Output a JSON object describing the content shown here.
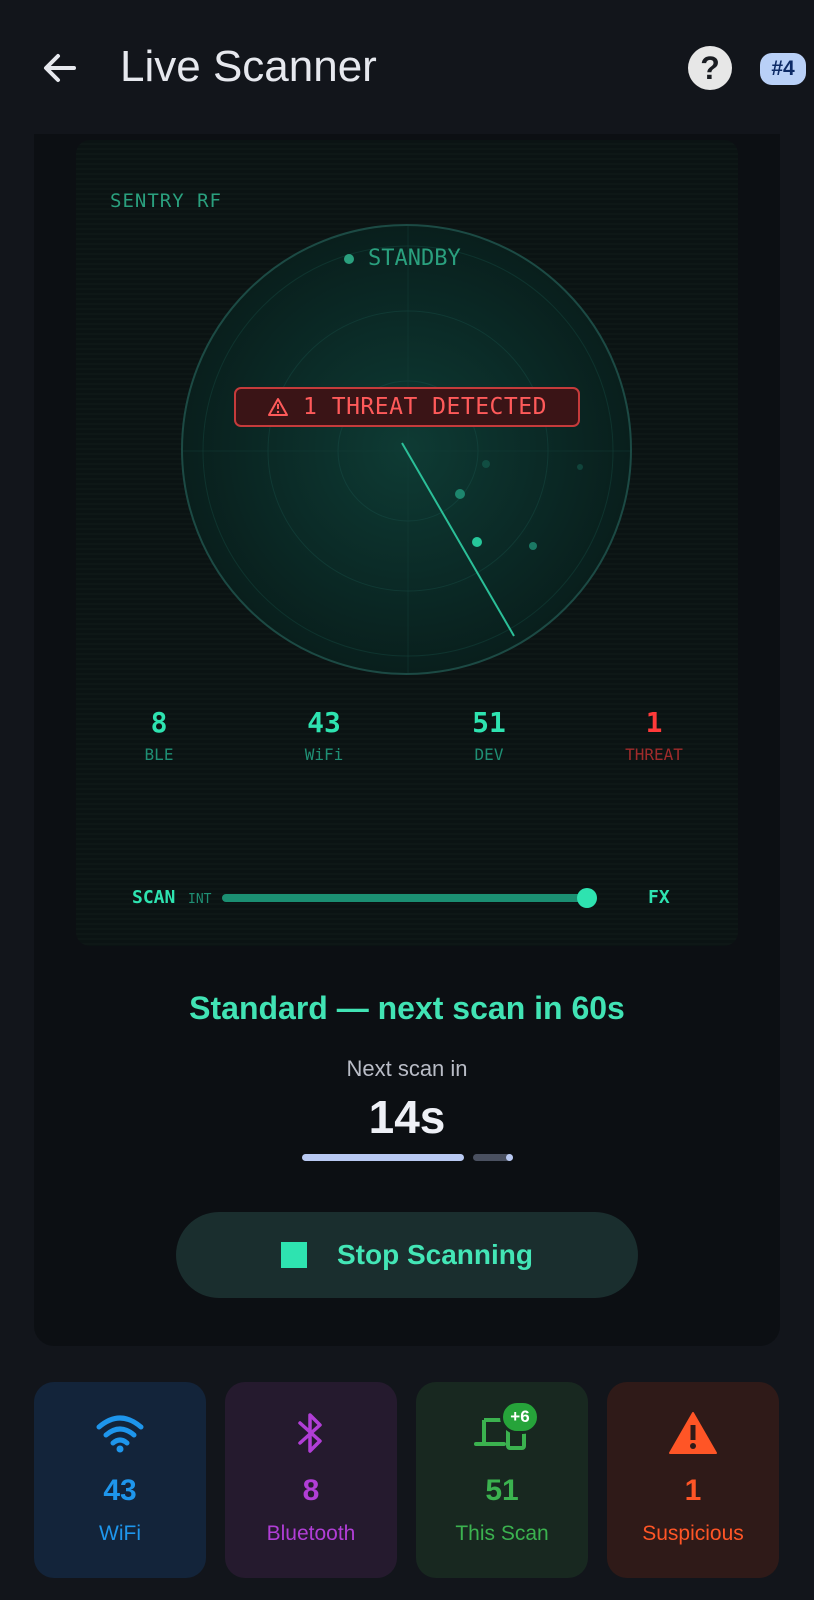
{
  "header": {
    "title": "Live Scanner",
    "back_icon": "arrow-left-icon",
    "help_label": "?",
    "tag_label": "#4"
  },
  "scanner": {
    "brand": "SENTRY RF",
    "status": "STANDBY",
    "threat_icon": "warning-icon",
    "threat_banner": "1 THREAT DETECTED",
    "stats": [
      {
        "value": "8",
        "label": "BLE"
      },
      {
        "value": "43",
        "label": "WiFi"
      },
      {
        "value": "51",
        "label": "DEV"
      },
      {
        "value": "1",
        "label": "THREAT"
      }
    ],
    "scan_label": "SCAN",
    "scan_sub": "INT",
    "fx_label": "FX",
    "slider_level": 0.97
  },
  "mode_text": "Standard — next scan in 60s",
  "next_scan_label": "Next scan in",
  "countdown": "14s",
  "countdown_progress": 0.77,
  "stop_button": {
    "label": "Stop Scanning",
    "icon": "stop-square-icon"
  },
  "tiles": [
    {
      "icon": "wifi-icon",
      "value": "43",
      "label": "WiFi",
      "color": "#1e96ec"
    },
    {
      "icon": "bluetooth-icon",
      "value": "8",
      "label": "Bluetooth",
      "color": "#b13ed6"
    },
    {
      "icon": "devices-icon",
      "value": "51",
      "label": "This Scan",
      "badge": "+6",
      "color": "#3bb24f"
    },
    {
      "icon": "warning-triangle-icon",
      "value": "1",
      "label": "Suspicious",
      "color": "#ff5526"
    }
  ],
  "colors": {
    "accent": "#2ee3b0",
    "threat": "#ff3a3a",
    "background": "#12151b"
  }
}
